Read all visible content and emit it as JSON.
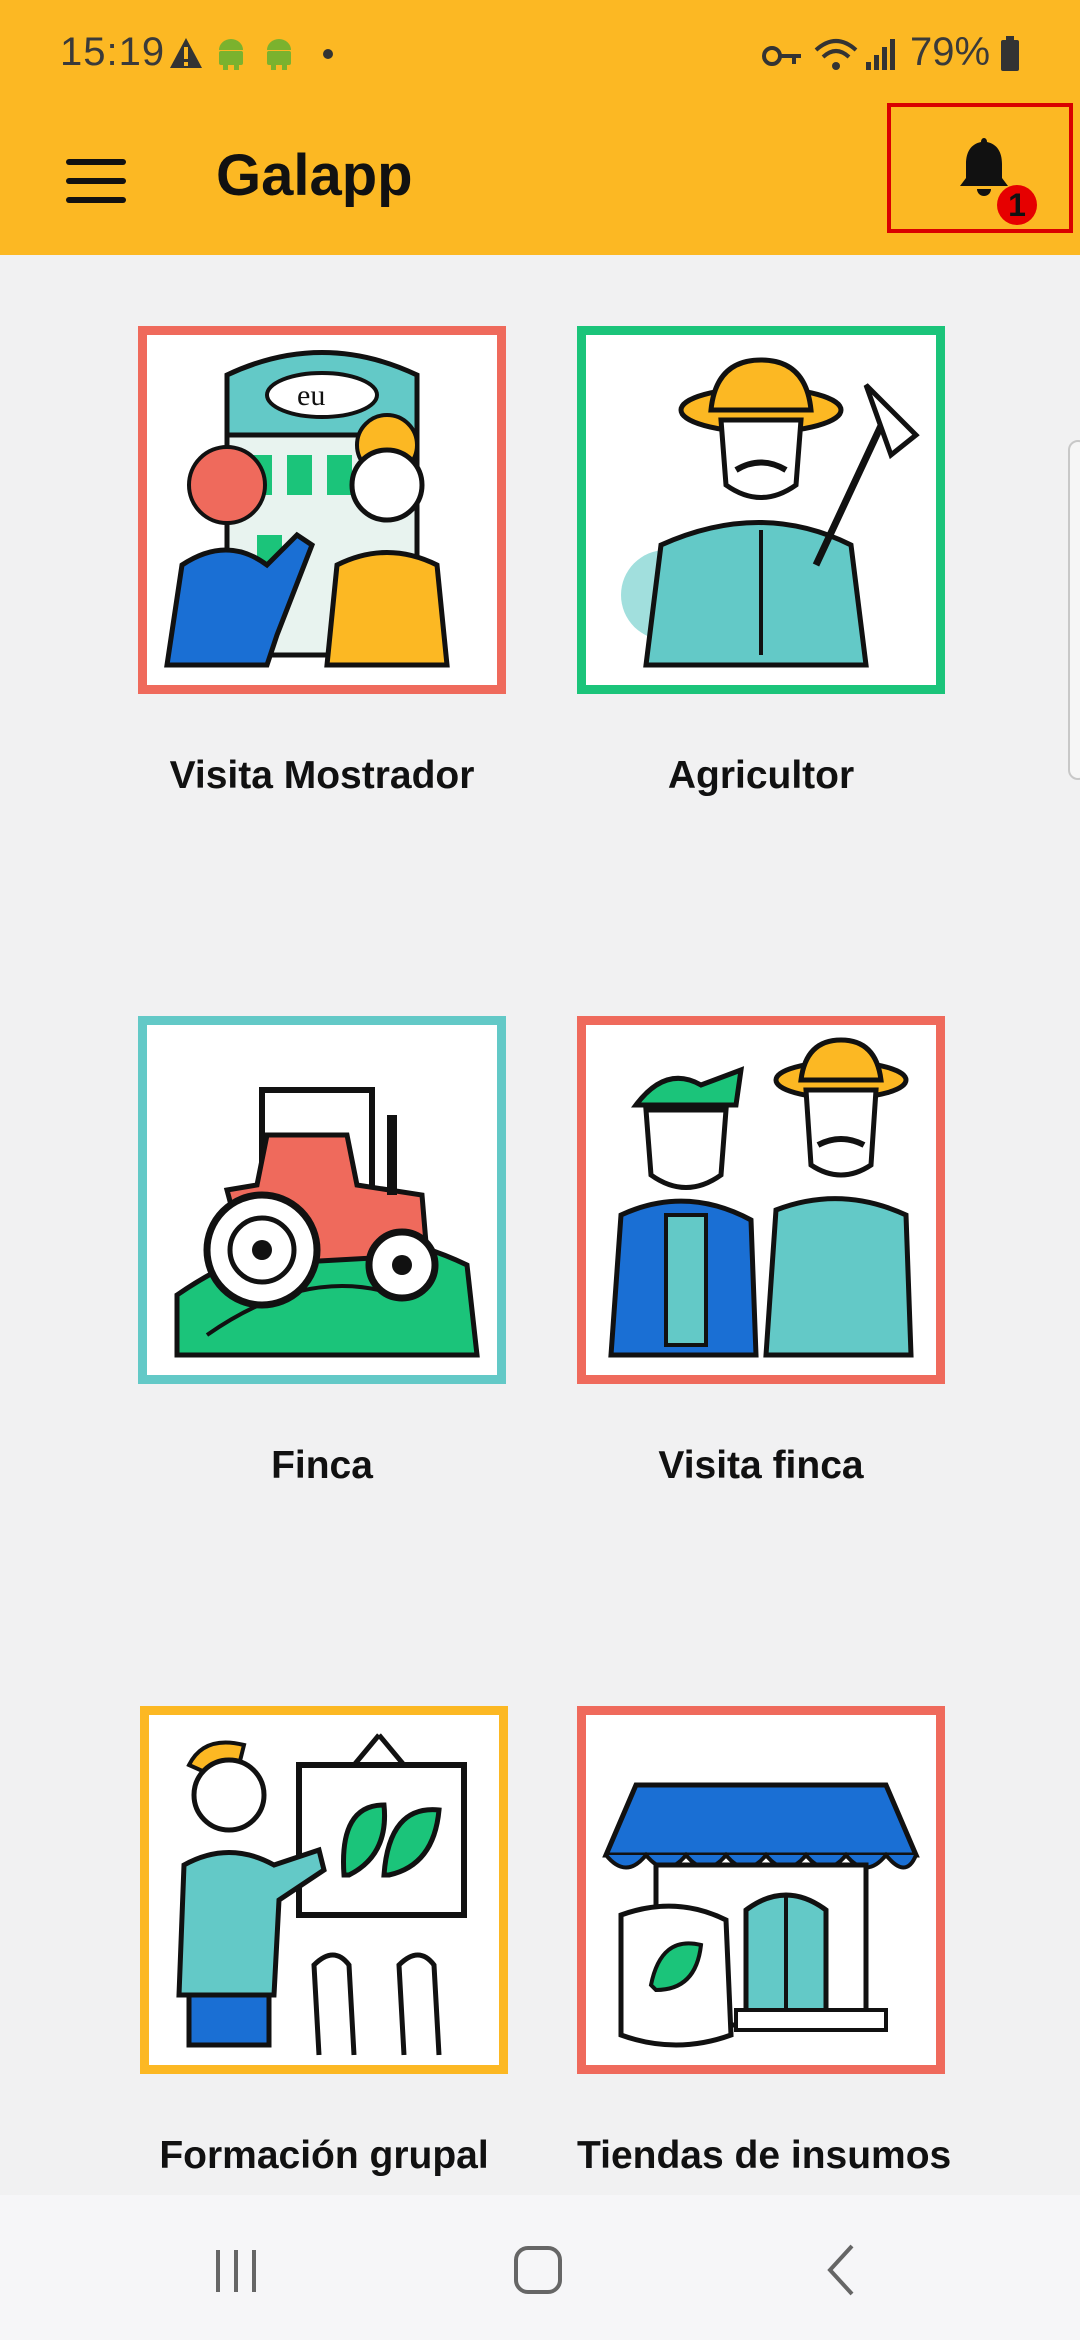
{
  "status_bar": {
    "time": "15:19",
    "battery": "79%",
    "icons": [
      "warning-icon",
      "android-icon",
      "android-icon",
      "dot-icon",
      "key-icon",
      "wifi-icon",
      "signal-icon",
      "battery-icon"
    ]
  },
  "app_bar": {
    "title": "Galapp",
    "menu_icon": "hamburger-menu-icon",
    "notification_icon": "bell-icon",
    "notification_count": "1"
  },
  "tiles": [
    {
      "label": "Visita Mostrador",
      "icon": "counter-visit-illustration",
      "border_color": "#ef6a5c"
    },
    {
      "label": "Agricultor",
      "icon": "farmer-illustration",
      "border_color": "#1bc47a"
    },
    {
      "label": "Finca",
      "icon": "tractor-illustration",
      "border_color": "#63c9c7"
    },
    {
      "label": "Visita finca",
      "icon": "farm-visit-illustration",
      "border_color": "#ef6a5c"
    },
    {
      "label": "Formación grupal",
      "icon": "group-training-illustration",
      "border_color": "#fcb823"
    },
    {
      "label": "Tiendas de insumos",
      "icon": "supply-store-illustration",
      "border_color": "#ef6a5c"
    }
  ],
  "nav_bar": {
    "recent_icon": "recent-apps-icon",
    "home_icon": "home-icon",
    "back_icon": "back-icon"
  }
}
